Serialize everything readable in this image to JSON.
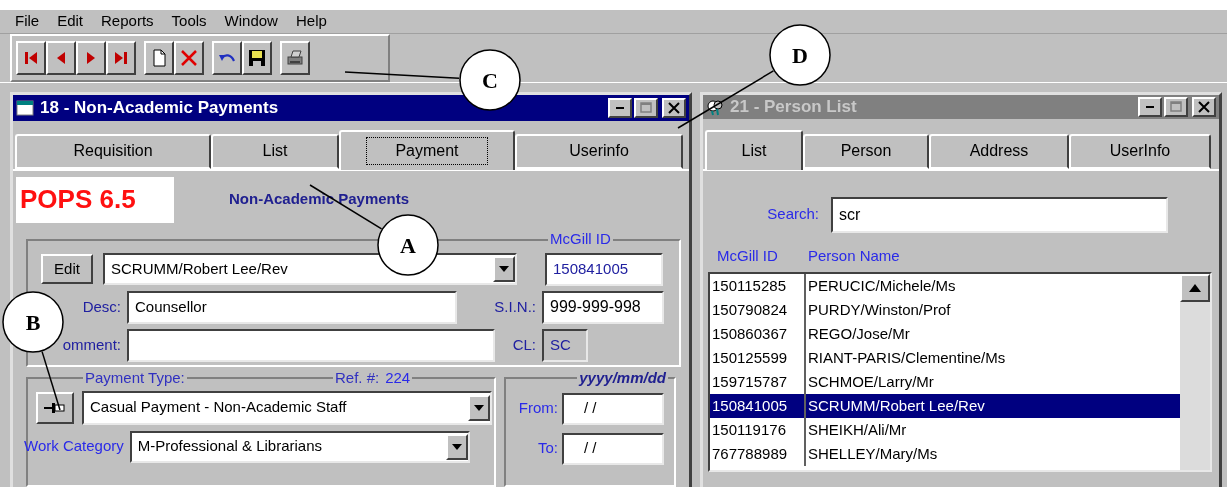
{
  "menu": [
    {
      "label": "File"
    },
    {
      "label": "Edit"
    },
    {
      "label": "Reports"
    },
    {
      "label": "Tools"
    },
    {
      "label": "Window"
    },
    {
      "label": "Help"
    }
  ],
  "left_window": {
    "title": "18 - Non-Academic Payments",
    "active": true,
    "tabs": [
      {
        "label": "Requisition",
        "selected": false
      },
      {
        "label": "List",
        "selected": false
      },
      {
        "label": "Payment",
        "selected": true
      },
      {
        "label": "Userinfo",
        "selected": false
      }
    ],
    "logo": "POPS 6.5",
    "heading": "Non-Academic Payments",
    "person_group": {
      "edit_button": "Edit",
      "person": "SCRUMM/Robert Lee/Rev",
      "mcgill_id_label": "McGill ID",
      "mcgill_id": "150841005",
      "desc_label": "Desc:",
      "desc": "Counsellor",
      "sin_label": "S.I.N.:",
      "sin": "999-999-998",
      "comment_label": "omment:",
      "cl_label": "CL:",
      "cl": "SC"
    },
    "payment_group": {
      "payment_type_label": "Payment Type:",
      "ref_label": "Ref. #:",
      "ref": "224",
      "payment_type": "Casual Payment - Non-Academic Staff",
      "work_category_label": "Work Category",
      "work_category": "M-Professional & Librarians"
    },
    "date_group": {
      "format": "yyyy/mm/dd",
      "from_label": "From:",
      "from": "/ /",
      "to_label": "To:",
      "to": "/ /"
    }
  },
  "right_window": {
    "title": "21 - Person List",
    "active": false,
    "tabs": [
      {
        "label": "List",
        "selected": true
      },
      {
        "label": "Person",
        "selected": false
      },
      {
        "label": "Address",
        "selected": false
      },
      {
        "label": "UserInfo",
        "selected": false
      }
    ],
    "search_label": "Search:",
    "search": "scr",
    "columns": [
      "McGill ID",
      "Person Name"
    ],
    "rows": [
      {
        "id": "150115285",
        "name": "PERUCIC/Michele/Ms",
        "selected": false
      },
      {
        "id": "150790824",
        "name": "PURDY/Winston/Prof",
        "selected": false
      },
      {
        "id": "150860367",
        "name": "REGO/Jose/Mr",
        "selected": false
      },
      {
        "id": "150125599",
        "name": "RIANT-PARIS/Clementine/Ms",
        "selected": false
      },
      {
        "id": "159715787",
        "name": "SCHMOE/Larry/Mr",
        "selected": false
      },
      {
        "id": "150841005",
        "name": "SCRUMM/Robert Lee/Rev",
        "selected": true
      },
      {
        "id": "150119176",
        "name": "SHEIKH/Ali/Mr",
        "selected": false
      },
      {
        "id": "767788989",
        "name": "SHELLEY/Mary/Ms",
        "selected": false
      }
    ]
  },
  "callouts": [
    {
      "label": "A"
    },
    {
      "label": "B"
    },
    {
      "label": "C"
    },
    {
      "label": "D"
    }
  ]
}
